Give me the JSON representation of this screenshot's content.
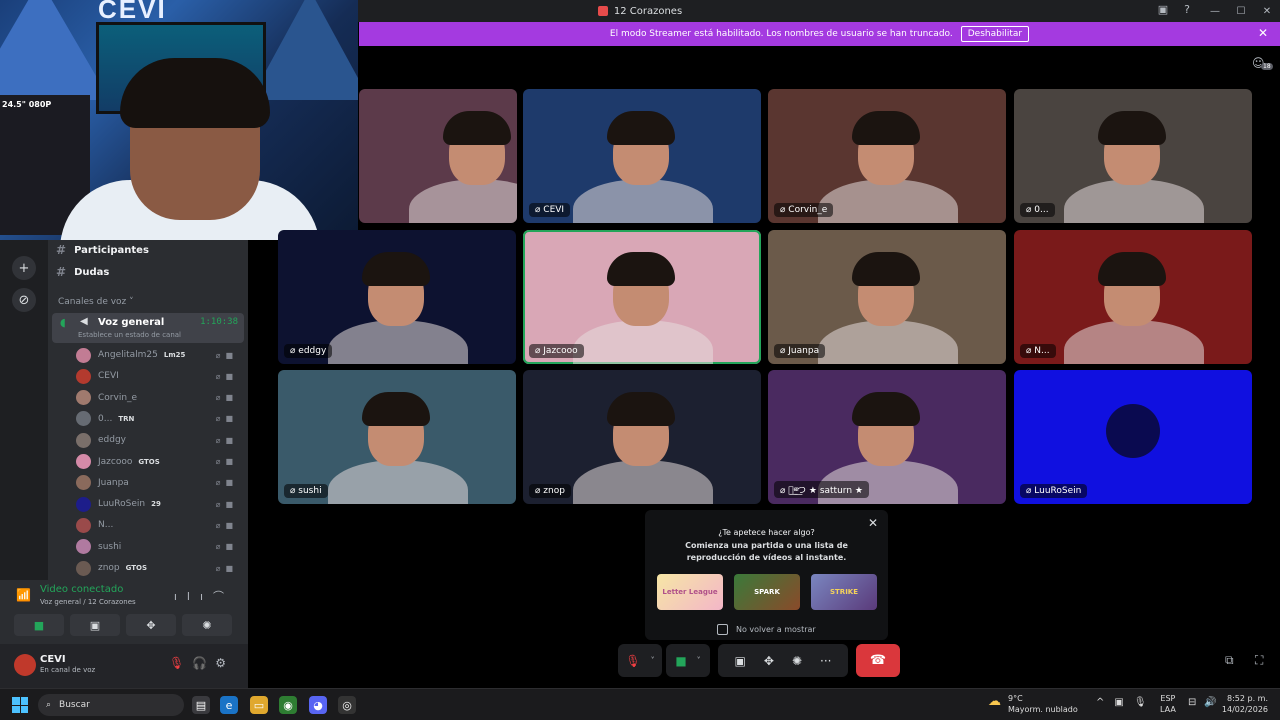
{
  "window": {
    "title": "12 Corazones",
    "min": "—",
    "max": "☐",
    "close": "✕"
  },
  "banner": {
    "text": "El modo Streamer está habilitado. Los nombres de usuario se han truncado.",
    "button": "Deshabilitar",
    "close": "✕"
  },
  "webcam": {
    "logo": "CEVI",
    "side_text": "24.5\" 080P"
  },
  "sidebar": {
    "text_channels": [
      {
        "name": "Participantes",
        "icon": "#"
      },
      {
        "name": "Dudas",
        "icon": "#"
      }
    ],
    "voice_category": "Canales de voz",
    "voice_channel": {
      "name": "Voz general",
      "timer": "1:10:38",
      "status_placeholder": "Establece un estado de canal"
    },
    "members": [
      {
        "name": "Angelitalm25",
        "badge": "Lm25",
        "color": "#c27c94"
      },
      {
        "name": "CEVI",
        "badge": "",
        "color": "#b33a2e"
      },
      {
        "name": "Corvin_e",
        "badge": "",
        "color": "#a07a6e"
      },
      {
        "name": "0...",
        "badge": "TRN",
        "color": "#666b73"
      },
      {
        "name": "eddgy",
        "badge": "",
        "color": "#7a6f6a"
      },
      {
        "name": "Jazcooo",
        "badge": "GTOS",
        "color": "#d58aa8"
      },
      {
        "name": "Juanpa",
        "badge": "",
        "color": "#8a6a5c"
      },
      {
        "name": "LuuRoSein",
        "badge": "29",
        "color": "#1d1d8a"
      },
      {
        "name": "N...",
        "badge": "",
        "color": "#9a4a4a"
      },
      {
        "name": "sushi",
        "badge": "",
        "color": "#b07aa0"
      },
      {
        "name": "znop",
        "badge": "GTOS",
        "color": "#6a5a52"
      }
    ]
  },
  "voice_panel": {
    "status": "Video conectado",
    "location": "Voz general / 12 Corazones"
  },
  "user": {
    "name": "CEVI",
    "status": "En canal de voz"
  },
  "tiles": [
    {
      "name": "",
      "bg": "#5c3a4a"
    },
    {
      "name": "CEVI",
      "bg": "#1e3a6b"
    },
    {
      "name": "Corvin_e",
      "bg": "#5a3630"
    },
    {
      "name": "0...",
      "bg": "#4a4440"
    },
    {
      "name": "eddgy",
      "bg": "#0d1230"
    },
    {
      "name": "Jazcooo",
      "bg": "#d9a7b6"
    },
    {
      "name": "Juanpa",
      "bg": "#6b5a4a"
    },
    {
      "name": "N...",
      "bg": "#7a1a1a"
    },
    {
      "name": "sushi",
      "bg": "#3a5a6a"
    },
    {
      "name": "znop",
      "bg": "#1c2030"
    },
    {
      "name": "ツ͟ᵉͤ͟つ ★ satturn ★",
      "bg": "#4a2a60"
    },
    {
      "name": "LuuRoSein",
      "bg": "#1010e0"
    }
  ],
  "activity_popup": {
    "question": "¿Te apetece hacer algo?",
    "description": "Comienza una partida o una lista de reproducción de vídeos al instante.",
    "games": [
      "Letter League",
      "SPARK",
      "STRIKE"
    ],
    "dont_show": "No volver a mostrar"
  },
  "taskbar": {
    "search_placeholder": "Buscar",
    "temp": "9°C",
    "weather": "Mayorm. nublado",
    "lang1": "ESP",
    "lang2": "LAA",
    "time": "8:52 p. m.",
    "date": "14/02/2026"
  },
  "people_count": "18",
  "colors": {
    "green": "#23a55a",
    "red": "#da373c",
    "banner": "#a43ae0"
  }
}
